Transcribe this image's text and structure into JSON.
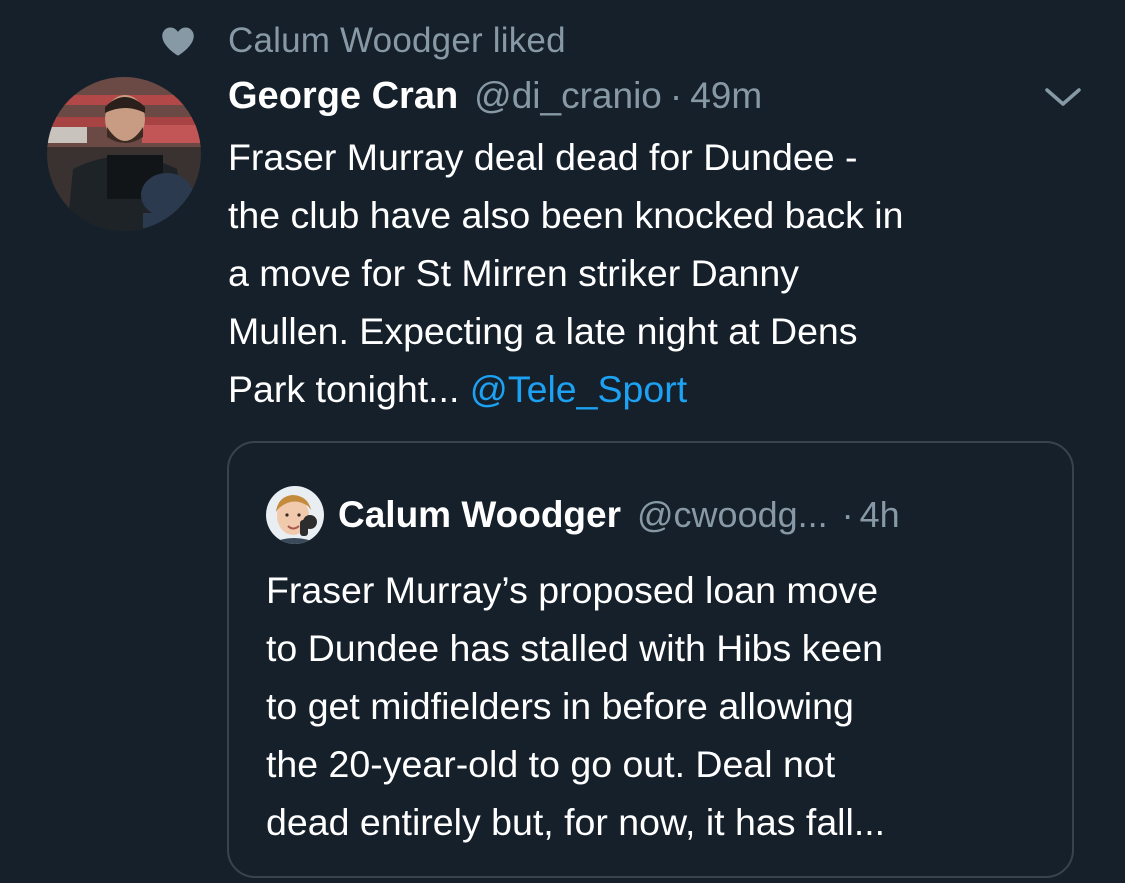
{
  "social_context": {
    "icon": "heart-icon",
    "text": "Calum Woodger liked"
  },
  "tweet": {
    "author_name": "George Cran",
    "author_handle": "@di_cranio",
    "separator": "·",
    "timestamp": "49m",
    "text_lines": [
      "Fraser Murray deal dead for Dundee -",
      "the club have also been knocked back in",
      "a move for St Mirren striker Danny",
      "Mullen. Expecting a late night at Dens",
      "Park tonight... "
    ],
    "mention": "@Tele_Sport",
    "menu_icon": "chevron-down-icon"
  },
  "quoted_tweet": {
    "author_name": "Calum Woodger",
    "author_handle": "@cwoodg...",
    "separator": "·",
    "timestamp": "4h",
    "text_lines": [
      "Fraser Murray’s proposed loan move",
      "to Dundee has stalled with Hibs keen",
      "to get midfielders in before allowing",
      "the 20-year-old to go out. Deal not",
      "dead entirely but, for now, it has fall..."
    ]
  },
  "colors": {
    "background": "#15202b",
    "primary_text": "#ffffff",
    "secondary_text": "#8899a6",
    "link": "#1da1f2",
    "border": "#38444d"
  }
}
